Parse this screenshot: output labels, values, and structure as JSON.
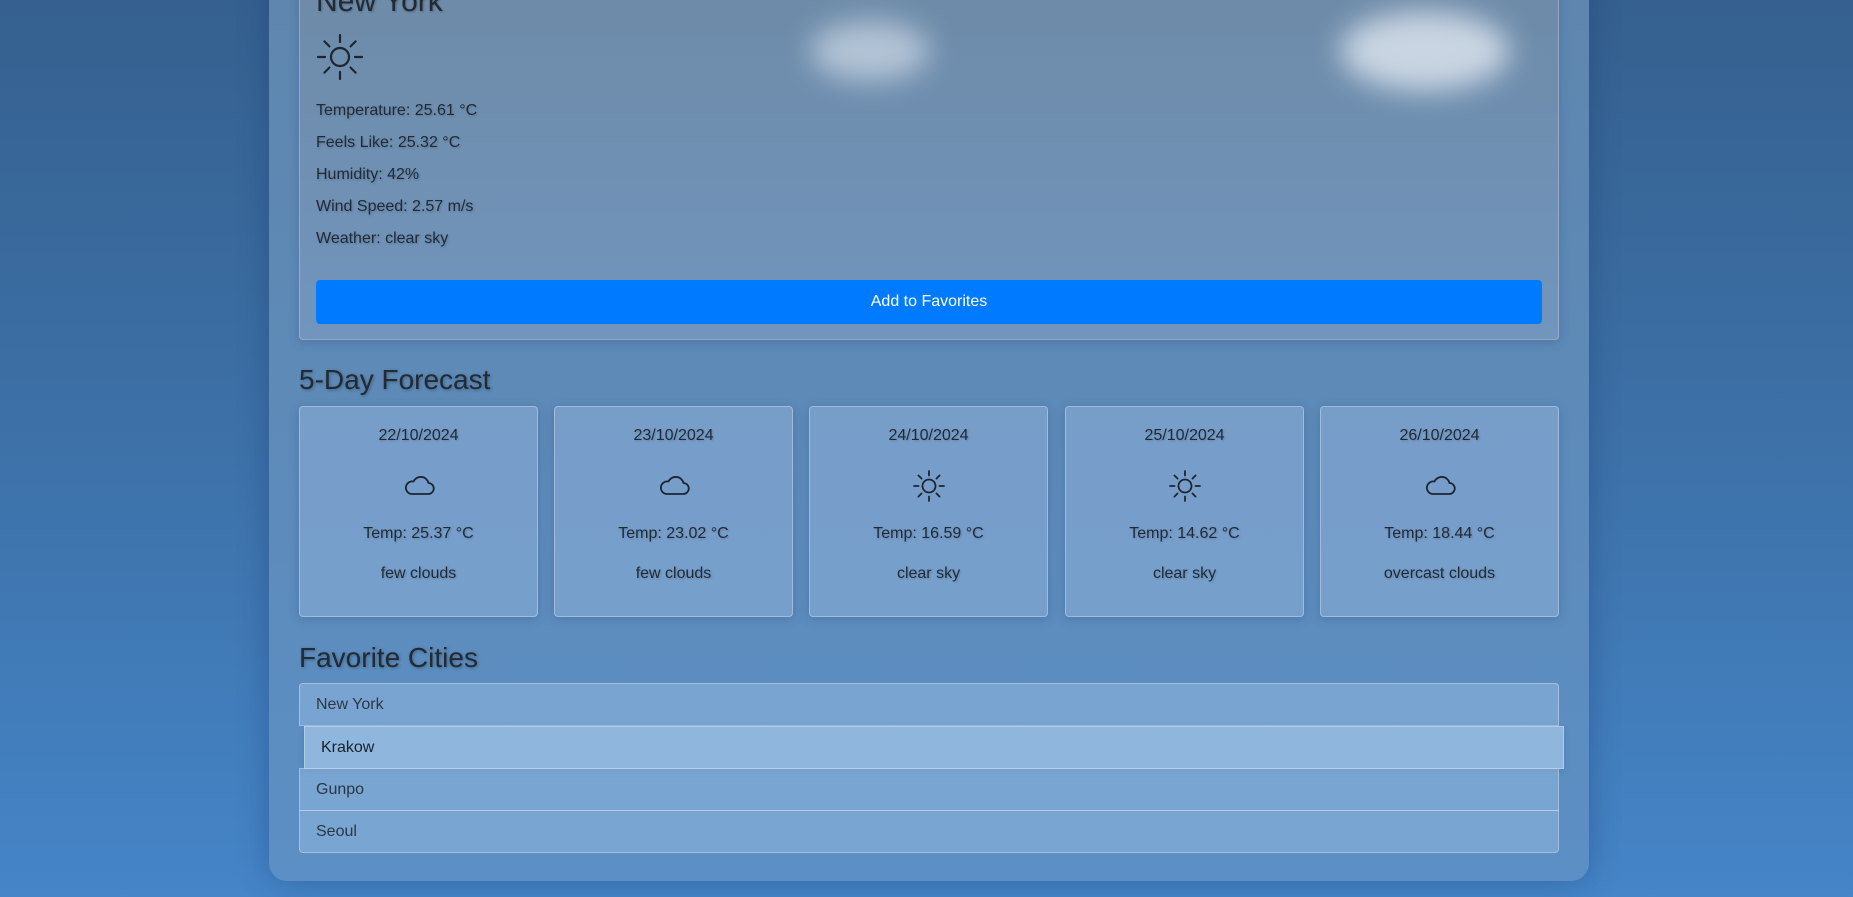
{
  "current": {
    "city": "New York",
    "icon": "sun-icon",
    "temperature": "Temperature: 25.61 °C",
    "feels_like": "Feels Like: 25.32 °C",
    "humidity": "Humidity: 42%",
    "wind_speed": "Wind Speed: 2.57 m/s",
    "weather": "Weather: clear sky",
    "add_favorite_label": "Add to Favorites"
  },
  "forecast": {
    "title": "5-Day Forecast",
    "days": [
      {
        "date": "22/10/2024",
        "icon": "cloud-icon",
        "temp": "Temp: 25.37 °C",
        "desc": "few clouds"
      },
      {
        "date": "23/10/2024",
        "icon": "cloud-icon",
        "temp": "Temp: 23.02 °C",
        "desc": "few clouds"
      },
      {
        "date": "24/10/2024",
        "icon": "sun-icon",
        "temp": "Temp: 16.59 °C",
        "desc": "clear sky"
      },
      {
        "date": "25/10/2024",
        "icon": "sun-icon",
        "temp": "Temp: 14.62 °C",
        "desc": "clear sky"
      },
      {
        "date": "26/10/2024",
        "icon": "cloud-icon",
        "temp": "Temp: 18.44 °C",
        "desc": "overcast clouds"
      }
    ]
  },
  "favorites": {
    "title": "Favorite Cities",
    "items": [
      "New York",
      "Krakow",
      "Gunpo",
      "Seoul"
    ]
  },
  "colors": {
    "button": "#007bff",
    "text": "#1f2a36"
  }
}
